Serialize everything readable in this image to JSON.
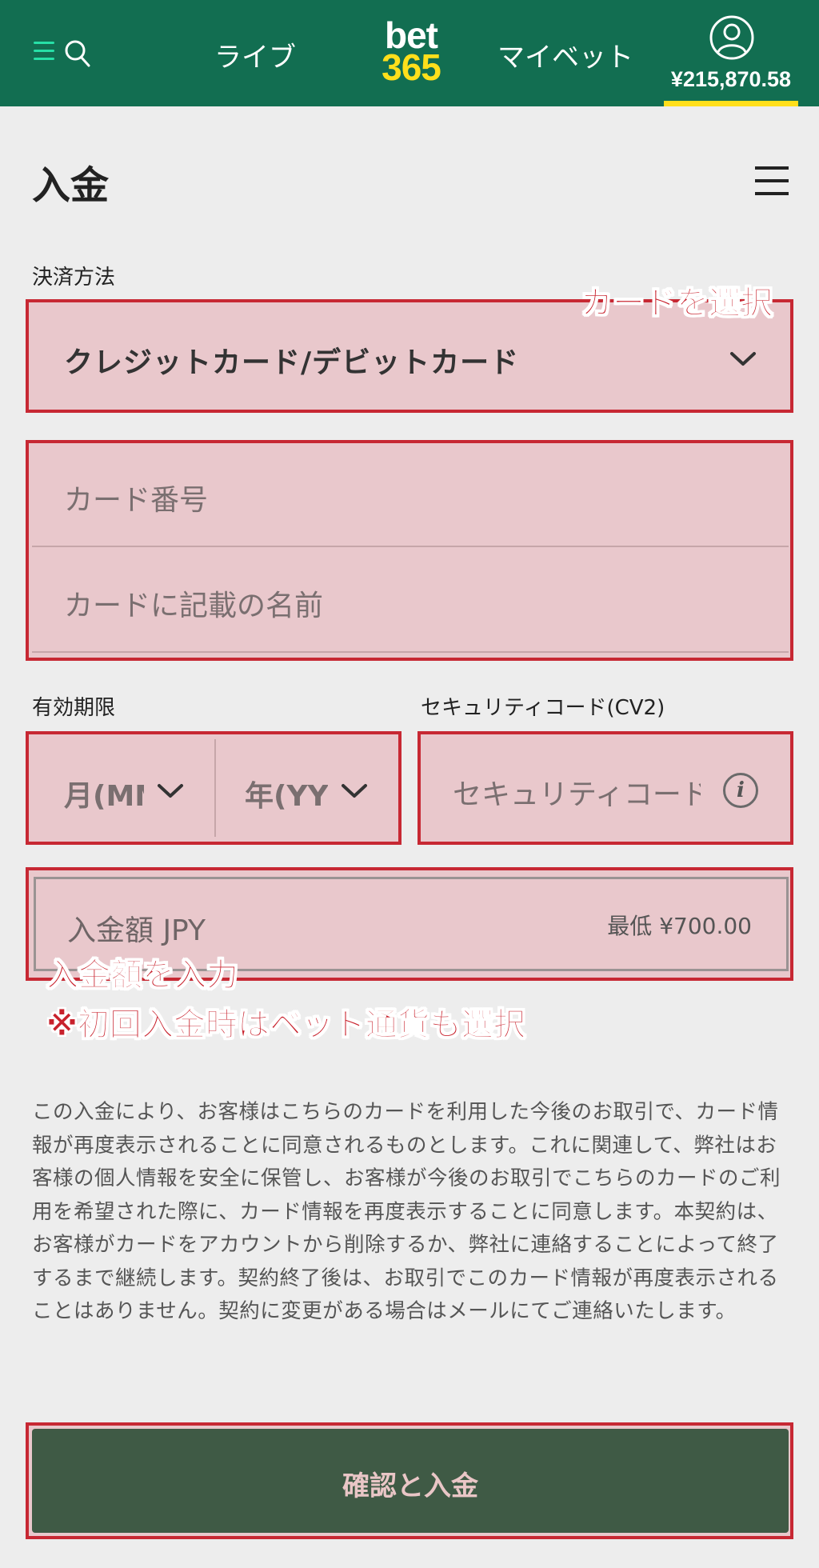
{
  "header": {
    "nav_live": "ライブ",
    "logo_top": "bet",
    "logo_bottom": "365",
    "nav_mybets": "マイベット",
    "balance": "¥215,870.58"
  },
  "page": {
    "title": "入金"
  },
  "payment": {
    "label": "決済方法",
    "selected_method": "クレジットカード/デビットカード"
  },
  "card": {
    "number_placeholder": "カード番号",
    "name_placeholder": "カードに記載の名前"
  },
  "expiry": {
    "label": "有効期限",
    "month_placeholder": "月(MM)",
    "year_placeholder": "年(YY)"
  },
  "security": {
    "label": "セキュリティコード(CV2)",
    "placeholder": "セキュリティコード",
    "info_icon": "i"
  },
  "amount": {
    "placeholder": "入金額 JPY",
    "minimum": "最低 ¥700.00"
  },
  "annotations": {
    "select_card": "カードを選択",
    "enter_amount": "入金額を入力",
    "first_deposit_note": "※初回入金時はベット通貨も選択"
  },
  "consent_text": "この入金により、お客様はこちらのカードを利用した今後のお取引で、カード情報が再度表示されることに同意されるものとします。これに関連して、弊社はお客様の個人情報を安全に保管し、お客様が今後のお取引でこちらのカードのご利用を希望された際に、カード情報を再度表示することに同意します。本契約は、お客様がカードをアカウントから削除するか、弊社に連絡することによって終了するまで継続します。契約終了後は、お取引でこのカード情報が再度表示されることはありません。契約に変更がある場合はメールにてご連絡いたします。",
  "confirm_button": "確認と入金",
  "colors": {
    "header_bg": "#126e51",
    "accent_yellow": "#ffdf1b",
    "annotation_red": "#c72833",
    "button_bg": "#3f5a45"
  }
}
